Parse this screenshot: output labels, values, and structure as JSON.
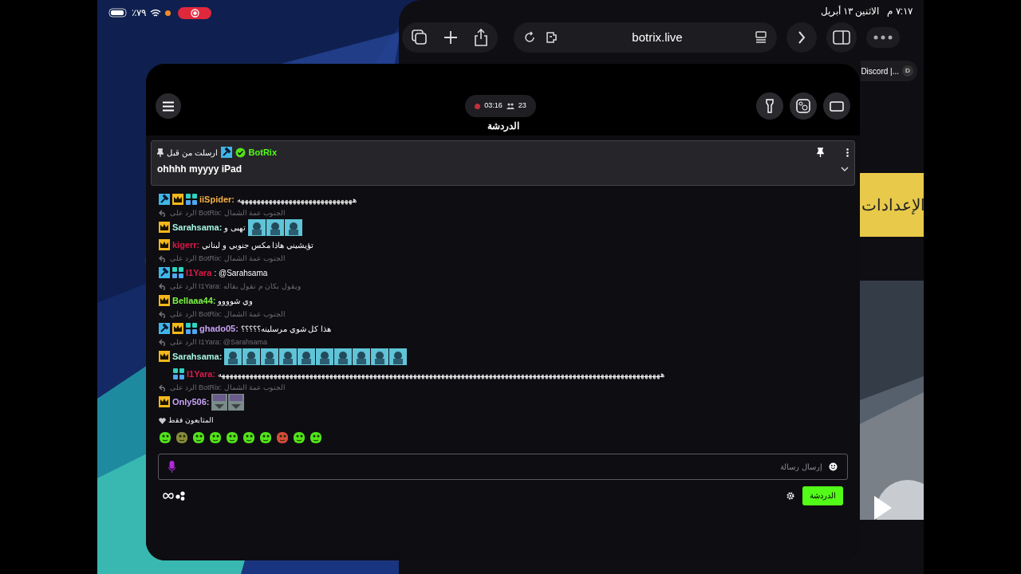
{
  "status_bar": {
    "battery": "٪٧٩",
    "time": "٧:١٧ م",
    "date": "الاثنين ١٣ أبريل"
  },
  "browser": {
    "url": "botrix.live",
    "tabs": [
      {
        "label": "Discord |...",
        "badge": "D"
      }
    ],
    "banner": "الإعدادات"
  },
  "chat": {
    "title": "الدردشة",
    "duration": "03:16",
    "viewers": "23",
    "pinned": {
      "author": "BotRix",
      "label": "ارسلت من قبل",
      "text": "ohhhh myyyy iPad",
      "badges": [
        {
          "kind": "mod"
        }
      ]
    },
    "messages": [
      {
        "kind": "message",
        "badges": [
          {
            "kind": "mod"
          },
          {
            "kind": "vip"
          },
          {
            "kind": "og"
          }
        ],
        "user": "iiSpider:",
        "color": "#f5b042",
        "text": "هههههههههههههههههههههههههههههه"
      },
      {
        "kind": "message",
        "reply": "الرد على BotRix: الجنوب عمة الشمال",
        "badges": [
          {
            "kind": "vip"
          }
        ],
        "user": "Sarahsama:",
        "color": "#a6f5e0",
        "text": "تهبى و",
        "emotes": [
          {
            "kind": "cat"
          },
          {
            "kind": "cat"
          },
          {
            "kind": "cat"
          }
        ]
      },
      {
        "kind": "message",
        "badges": [
          {
            "kind": "vip"
          }
        ],
        "user": "kigerr:",
        "color": "#d81b4a",
        "text": "تؤيشيني هاذا مكس جنوبي و لبناني"
      },
      {
        "kind": "message",
        "reply": "الرد على BotRix: الجنوب عمة الشمال",
        "badges": [
          {
            "kind": "mod"
          },
          {
            "kind": "og"
          }
        ],
        "user": "I1Yara",
        "color": "#d81b4a",
        "text": ": @Sarahsama"
      },
      {
        "kind": "message",
        "reply": "الرد على I1Yara: ويقول بكان م نقول بقاله",
        "badges": [
          {
            "kind": "vip"
          }
        ],
        "user": "Bellaaa44:",
        "color": "#7cf542",
        "text": "وي شوووو"
      },
      {
        "kind": "message",
        "reply": "الرد على BotRix: الجنوب عمة الشمال",
        "badges": [
          {
            "kind": "mod"
          },
          {
            "kind": "vip"
          },
          {
            "kind": "og"
          }
        ],
        "user": "ghado05:",
        "color": "#c8a2f5",
        "text": "هذا كل شوي مرسلينه؟؟؟؟؟"
      },
      {
        "kind": "message",
        "reply": "الرد على I1Yara: @Sarahsama",
        "badges": [
          {
            "kind": "vip"
          }
        ],
        "user": "Sarahsama:",
        "color": "#a6f5e0",
        "emotes": [
          {
            "kind": "cat"
          },
          {
            "kind": "cat"
          },
          {
            "kind": "cat"
          },
          {
            "kind": "cat"
          },
          {
            "kind": "cat"
          },
          {
            "kind": "cat"
          },
          {
            "kind": "cat"
          },
          {
            "kind": "cat"
          },
          {
            "kind": "cat"
          },
          {
            "kind": "cat"
          }
        ]
      },
      {
        "kind": "continuation",
        "badges": [
          {
            "kind": "og"
          }
        ],
        "user": "I1Yara:",
        "color": "#d81b4a",
        "text": "هههههههههههههههههههههههههههههههههههههههههههههههههههههههههههههههههههههههههههههههههههههههههههههههههههههههههههههههه"
      },
      {
        "kind": "message",
        "reply": "الرد على BotRix: الجنوب عمة الشمال",
        "badges": [
          {
            "kind": "vip"
          }
        ],
        "user": "Only506:",
        "color": "#c8a2f5",
        "emotes": [
          {
            "kind": "sign"
          },
          {
            "kind": "sign"
          }
        ]
      }
    ],
    "followers_only": "المتابعون فقط",
    "input": {
      "placeholder": "إرسال رسالة"
    },
    "send_button": "الدردشة"
  }
}
